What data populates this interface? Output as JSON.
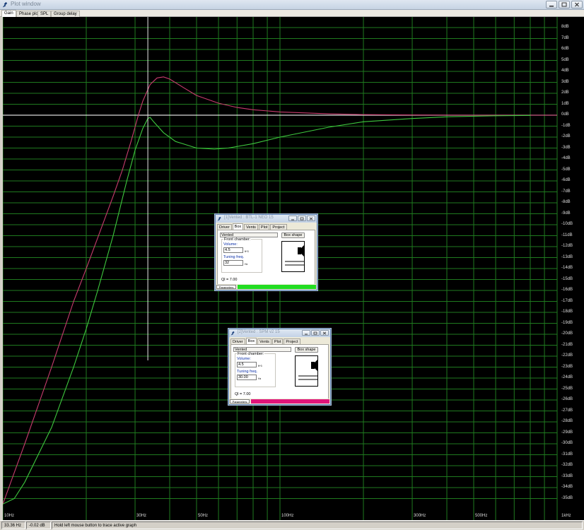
{
  "window": {
    "title": "Plot window",
    "colors": {
      "title_text": "#7a8797"
    }
  },
  "tabs": [
    {
      "label": "Gain",
      "active": true
    },
    {
      "label": "Phase plot",
      "active": false
    },
    {
      "label": "SPL",
      "active": false
    },
    {
      "label": "Group delay",
      "active": false
    }
  ],
  "plot": {
    "background": "#000000",
    "grid_color": "#1f7a1f",
    "zero_line_color": "#ffffff",
    "y_labels": [
      "8dB",
      "7dB",
      "6dB",
      "5dB",
      "4dB",
      "3dB",
      "2dB",
      "1dB",
      "0dB",
      "-1dB",
      "-2dB",
      "-3dB",
      "-4dB",
      "-5dB",
      "-6dB",
      "-7dB",
      "-8dB",
      "-9dB",
      "-10dB",
      "-11dB",
      "-12dB",
      "-13dB",
      "-14dB",
      "-15dB",
      "-16dB",
      "-17dB",
      "-18dB",
      "-19dB",
      "-20dB",
      "-21dB",
      "-22dB",
      "-23dB",
      "-24dB",
      "-25dB",
      "-26dB",
      "-27dB",
      "-28dB",
      "-29dB",
      "-30dB",
      "-31dB",
      "-32dB",
      "-33dB",
      "-34dB",
      "-35dB"
    ],
    "x_labels": [
      {
        "label": "10Hz",
        "freq": 10
      },
      {
        "label": "30Hz",
        "freq": 30
      },
      {
        "label": "50Hz",
        "freq": 50
      },
      {
        "label": "100Hz",
        "freq": 100
      },
      {
        "label": "300Hz",
        "freq": 300
      },
      {
        "label": "500Hz",
        "freq": 500
      },
      {
        "label": "1kHz",
        "freq": 1000
      }
    ],
    "cursor_freq_hz": 33.36,
    "series": [
      {
        "id": "trace-1",
        "color": "#c83c6e",
        "points": [
          [
            10,
            -35.5
          ],
          [
            12,
            -30
          ],
          [
            15,
            -23
          ],
          [
            18,
            -17
          ],
          [
            20,
            -14
          ],
          [
            22,
            -11.2
          ],
          [
            25,
            -7.4
          ],
          [
            27,
            -5
          ],
          [
            29,
            -2.4
          ],
          [
            31,
            0.2
          ],
          [
            32,
            1.3
          ],
          [
            34,
            2.8
          ],
          [
            36,
            3.4
          ],
          [
            38,
            3.5
          ],
          [
            40,
            3.3
          ],
          [
            45,
            2.5
          ],
          [
            50,
            1.8
          ],
          [
            60,
            1.1
          ],
          [
            70,
            0.7
          ],
          [
            80,
            0.5
          ],
          [
            100,
            0.3
          ],
          [
            150,
            0.12
          ],
          [
            200,
            0.05
          ],
          [
            300,
            0.02
          ],
          [
            500,
            0.0
          ],
          [
            1000,
            0.0
          ]
        ]
      },
      {
        "id": "trace-2",
        "color": "#3ec83e",
        "points": [
          [
            10,
            -35.5
          ],
          [
            11,
            -35
          ],
          [
            12,
            -33.5
          ],
          [
            15,
            -28.5
          ],
          [
            18,
            -23
          ],
          [
            20,
            -19.5
          ],
          [
            22,
            -16
          ],
          [
            25,
            -11
          ],
          [
            28,
            -6
          ],
          [
            30,
            -3.2
          ],
          [
            32,
            -1.2
          ],
          [
            33.36,
            -0.3
          ],
          [
            34,
            -0.2
          ],
          [
            35,
            -0.6
          ],
          [
            38,
            -1.6
          ],
          [
            42,
            -2.4
          ],
          [
            50,
            -3.0
          ],
          [
            58,
            -3.1
          ],
          [
            65,
            -3.0
          ],
          [
            80,
            -2.6
          ],
          [
            100,
            -2.0
          ],
          [
            150,
            -1.1
          ],
          [
            200,
            -0.6
          ],
          [
            300,
            -0.3
          ],
          [
            400,
            -0.15
          ],
          [
            600,
            -0.05
          ],
          [
            800,
            -0.02
          ]
        ]
      }
    ]
  },
  "status": {
    "freq": "33.36 Hz",
    "db": "-0.02 dB",
    "hint": "Hold left mouse button to trace active graph"
  },
  "box_windows": [
    {
      "title": "[1]Vented : BTL-1 NEO 15",
      "tabs": [
        {
          "label": "Driver",
          "active": false
        },
        {
          "label": "Box",
          "active": true
        },
        {
          "label": "Vents",
          "active": false
        },
        {
          "label": "Plot",
          "active": false
        },
        {
          "label": "Project",
          "active": false
        }
      ],
      "box_type": "Vented",
      "box_shape_label": "Box shape",
      "group_label": "Front chamber:",
      "volume_label": "Volume:",
      "volume_value": "4.5",
      "volume_unit": "ft^3",
      "tuning_label": "Tuning freq.",
      "tuning_value": "32",
      "tuning_unit": "Hz",
      "ql": "Ql = 7.00",
      "params_label": "Parameters",
      "color": "#22dd22"
    },
    {
      "title": "[2]Vented : SPM v2 15",
      "tabs": [
        {
          "label": "Driver",
          "active": false
        },
        {
          "label": "Box",
          "active": true
        },
        {
          "label": "Vents",
          "active": false
        },
        {
          "label": "Plot",
          "active": false
        },
        {
          "label": "Project",
          "active": false
        }
      ],
      "box_type": "Vented",
      "box_shape_label": "Box shape",
      "group_label": "Front chamber:",
      "volume_label": "Volume:",
      "volume_value": "4.5",
      "volume_unit": "ft^3",
      "tuning_label": "Tuning freq.",
      "tuning_value": "30.00",
      "tuning_unit": "Hz",
      "ql": "Ql = 7.00",
      "params_label": "Parameters",
      "color": "#e0157a"
    }
  ]
}
